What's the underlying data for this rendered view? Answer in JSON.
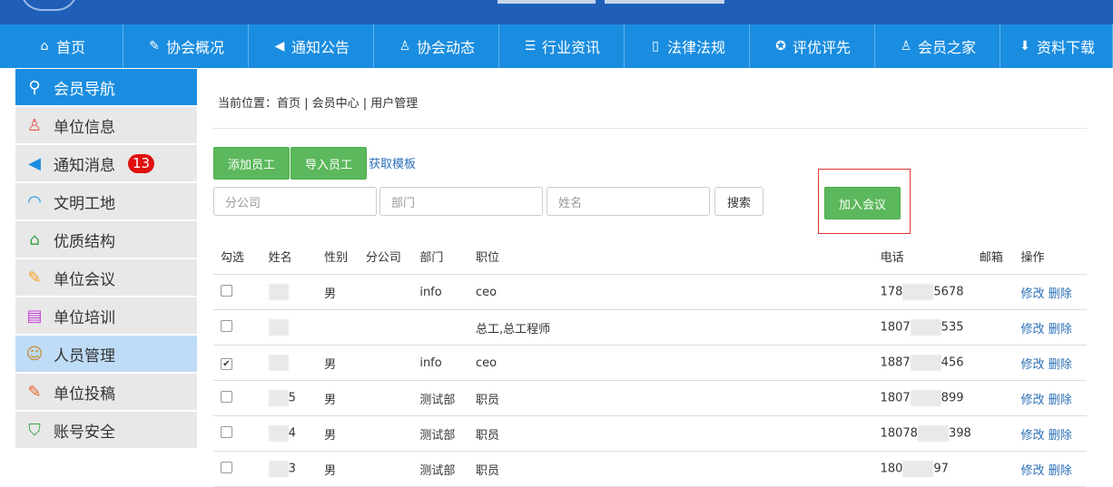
{
  "nav": [
    {
      "label": "首页",
      "icon": "home-icon"
    },
    {
      "label": "协会概况",
      "icon": "edit-doc-icon"
    },
    {
      "label": "通知公告",
      "icon": "speaker-icon"
    },
    {
      "label": "协会动态",
      "icon": "user-icon"
    },
    {
      "label": "行业资讯",
      "icon": "list-doc-icon"
    },
    {
      "label": "法律法规",
      "icon": "book-icon"
    },
    {
      "label": "评优评先",
      "icon": "award-icon"
    },
    {
      "label": "会员之家",
      "icon": "user-icon"
    },
    {
      "label": "资料下载",
      "icon": "download-icon"
    }
  ],
  "sidebar": [
    {
      "label": "会员导航",
      "icon": "map-pin-icon"
    },
    {
      "label": "单位信息",
      "icon": "person-icon"
    },
    {
      "label": "通知消息",
      "icon": "speaker-icon",
      "badge": "13"
    },
    {
      "label": "文明工地",
      "icon": "helmet-icon"
    },
    {
      "label": "优质结构",
      "icon": "house-icon"
    },
    {
      "label": "单位会议",
      "icon": "pen-list-icon"
    },
    {
      "label": "单位培训",
      "icon": "clipboard-icon"
    },
    {
      "label": "人员管理",
      "icon": "people-icon"
    },
    {
      "label": "单位投稿",
      "icon": "edit-icon"
    },
    {
      "label": "账号安全",
      "icon": "shield-icon"
    }
  ],
  "breadcrumb": "当前位置：首页 | 会员中心 | 用户管理",
  "toolbar": {
    "add": "添加员工",
    "import": "导入员工",
    "template": "获取模板",
    "join": "加入会议"
  },
  "search": {
    "branch_ph": "分公司",
    "dept_ph": "部门",
    "name_ph": "姓名",
    "button": "搜索"
  },
  "table": {
    "headers": [
      "勾选",
      "姓名",
      "性别",
      "分公司",
      "部门",
      "职位",
      "电话",
      "邮箱",
      "操作"
    ],
    "edit": "修改",
    "delete": "删除",
    "rows": [
      {
        "checked": false,
        "name": "",
        "gender": "男",
        "branch": "",
        "dept": "info",
        "pos": "ceo",
        "tel_a": "178",
        "tel_b": "5678"
      },
      {
        "checked": false,
        "name": "",
        "gender": "",
        "branch": "",
        "dept": "",
        "pos": "总工,总工程师",
        "tel_a": "1807",
        "tel_b": "535"
      },
      {
        "checked": true,
        "name": "",
        "gender": "男",
        "branch": "",
        "dept": "info",
        "pos": "ceo",
        "tel_a": "1887",
        "tel_b": "456"
      },
      {
        "checked": false,
        "name": "5",
        "gender": "男",
        "branch": "",
        "dept": "测试部",
        "pos": "职员",
        "tel_a": "1807",
        "tel_b": "899"
      },
      {
        "checked": false,
        "name": "4",
        "gender": "男",
        "branch": "",
        "dept": "测试部",
        "pos": "职员",
        "tel_a": "18078",
        "tel_b": "398"
      },
      {
        "checked": false,
        "name": "3",
        "gender": "男",
        "branch": "",
        "dept": "测试部",
        "pos": "职员",
        "tel_a": "180",
        "tel_b": "97"
      }
    ]
  }
}
